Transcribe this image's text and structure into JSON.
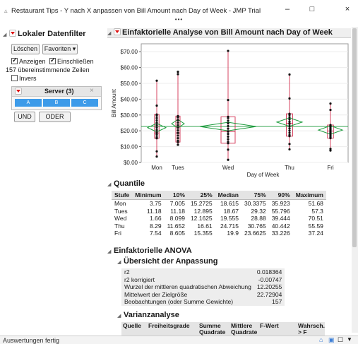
{
  "window": {
    "title": "Restaurant Tips - Y nach X anpassen von Bill Amount nach Day of Week - JMP Trial",
    "minimize": "–",
    "maximize": "□",
    "close": "×",
    "overflow_dots": "•••"
  },
  "filter": {
    "title": "Lokaler Datenfilter",
    "clear_label": "Löschen",
    "favorites_label": "Favoriten ▾",
    "show_label": "Anzeigen",
    "include_label": "Einschließen",
    "matching_rows": "157 übereinstimmende Zeilen",
    "invert_label": "Invers",
    "server_title": "Server (3)",
    "server_close": "×",
    "levels": [
      "A",
      "B",
      "C"
    ],
    "and_label": "UND",
    "or_label": "ODER"
  },
  "oneway": {
    "title": "Einfaktorielle Analyse von Bill Amount nach Day of Week"
  },
  "chart_data": {
    "type": "scatter",
    "title": "",
    "xlabel": "Day of Week",
    "ylabel": "Bill Amount",
    "categories": [
      "Mon",
      "Tues",
      "Wed",
      "Thu",
      "Fri"
    ],
    "ylim": [
      0,
      75
    ],
    "yticks": [
      "$0.00",
      "$10.00",
      "$20.00",
      "$30.00",
      "$40.00",
      "$50.00",
      "$60.00",
      "$70.00"
    ],
    "means": [
      22.0,
      24.5,
      22.7,
      25.5,
      20.5
    ],
    "quantiles": {
      "Mon": [
        3.75,
        7.005,
        15.2725,
        18.615,
        30.3375,
        35.923,
        51.68
      ],
      "Tues": [
        11.18,
        11.18,
        12.895,
        18.67,
        29.32,
        55.796,
        57.3
      ],
      "Wed": [
        1.66,
        8.099,
        12.1625,
        19.555,
        28.88,
        39.444,
        70.51
      ],
      "Thu": [
        8.29,
        11.652,
        16.61,
        24.715,
        30.765,
        40.442,
        55.59
      ],
      "Fri": [
        7.54,
        8.605,
        15.355,
        19.9,
        23.6625,
        33.226,
        37.24
      ]
    },
    "grid": true
  },
  "quantile_table": {
    "title": "Quantile",
    "headers": [
      "Stufe",
      "Minimum",
      "10%",
      "25%",
      "Median",
      "75%",
      "90%",
      "Maximum"
    ],
    "rows": [
      [
        "Mon",
        "3.75",
        "7.005",
        "15.2725",
        "18.615",
        "30.3375",
        "35.923",
        "51.68"
      ],
      [
        "Tues",
        "11.18",
        "11.18",
        "12.895",
        "18.67",
        "29.32",
        "55.796",
        "57.3"
      ],
      [
        "Wed",
        "1.66",
        "8.099",
        "12.1625",
        "19.555",
        "28.88",
        "39.444",
        "70.51"
      ],
      [
        "Thu",
        "8.29",
        "11.652",
        "16.61",
        "24.715",
        "30.765",
        "40.442",
        "55.59"
      ],
      [
        "Fri",
        "7.54",
        "8.605",
        "15.355",
        "19.9",
        "23.6625",
        "33.226",
        "37.24"
      ]
    ]
  },
  "anova": {
    "title": "Einfaktorielle ANOVA",
    "fit_title": "Übersicht der Anpassung",
    "fit_rows": [
      [
        "r2",
        "0.018364"
      ],
      [
        "r2 korrigiert",
        "-0.00747"
      ],
      [
        "Wurzel der mittleren quadratischen Abweichung",
        "12.20255"
      ],
      [
        "Mittelwert der Zielgröße",
        "22.72904"
      ],
      [
        "Beobachtungen (oder Summe Gewichte)",
        "157"
      ]
    ],
    "variance_title": "Varianzanalyse",
    "variance_headers": [
      "Quelle",
      "Freiheitsgrade",
      "Summe Quadrate",
      "Mittlere Quadrate",
      "F-Wert",
      "Wahrsch. > F"
    ]
  },
  "status": {
    "text": "Auswertungen fertig"
  }
}
